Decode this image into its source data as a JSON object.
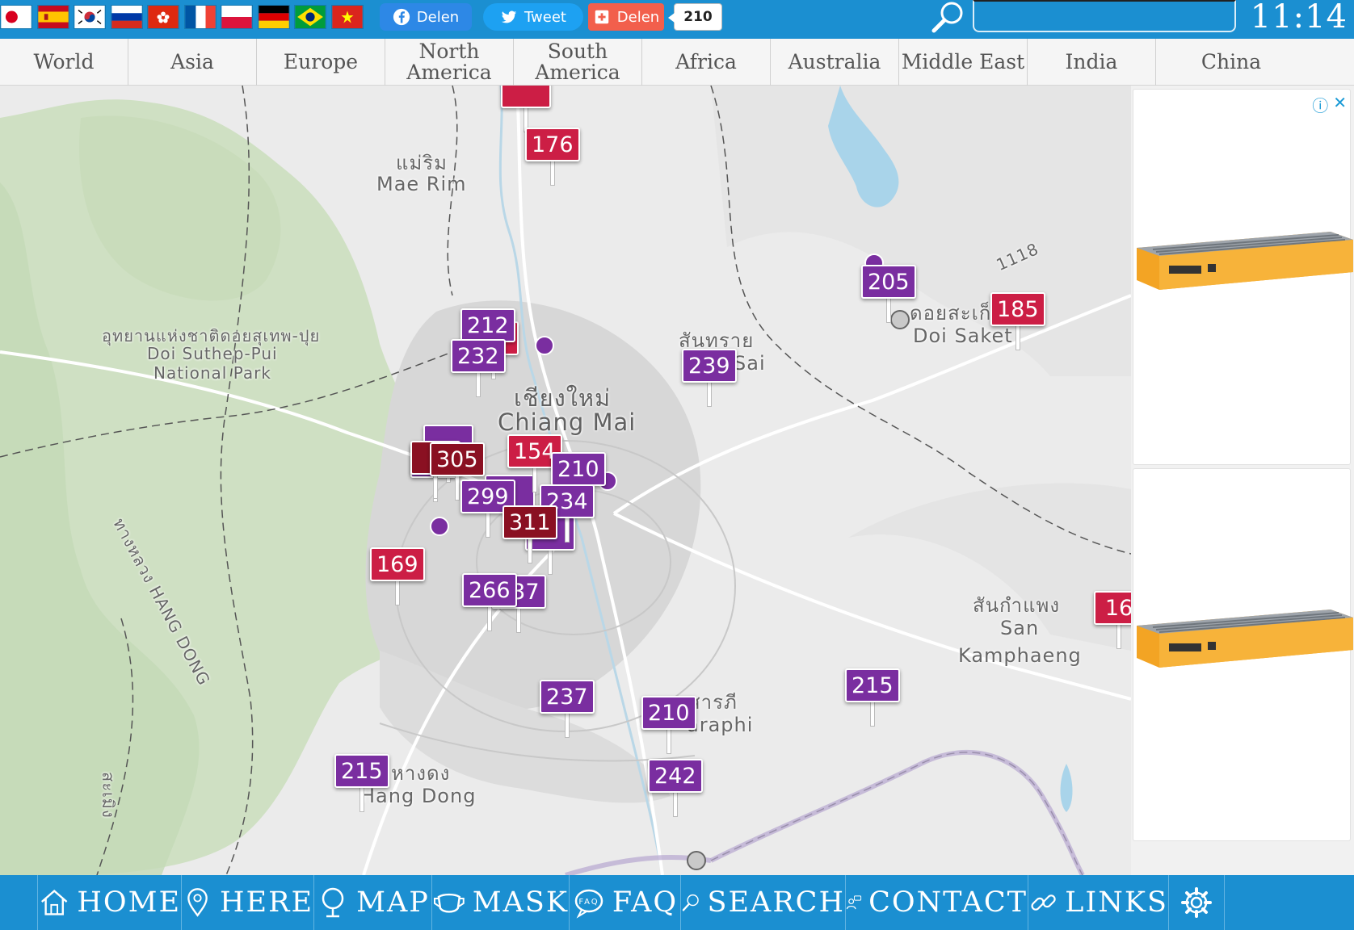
{
  "flags": [
    {
      "name": "japan-flag"
    },
    {
      "name": "spain-flag"
    },
    {
      "name": "korea-flag"
    },
    {
      "name": "russia-flag"
    },
    {
      "name": "hong-kong-flag"
    },
    {
      "name": "france-flag"
    },
    {
      "name": "poland-flag"
    },
    {
      "name": "germany-flag"
    },
    {
      "name": "brazil-flag"
    },
    {
      "name": "vietnam-flag"
    }
  ],
  "share": {
    "facebook_label": "Delen",
    "tweet_label": "Tweet",
    "add_label": "Delen",
    "count": "210"
  },
  "search": {
    "value": "",
    "placeholder": ""
  },
  "clock": "11:14",
  "tabs": [
    {
      "label": "World"
    },
    {
      "label": "Asia"
    },
    {
      "label": "Europe"
    },
    {
      "label": "North America"
    },
    {
      "label": "South America"
    },
    {
      "label": "Africa"
    },
    {
      "label": "Australia"
    },
    {
      "label": "Middle East"
    },
    {
      "label": "India"
    },
    {
      "label": "China"
    }
  ],
  "map": {
    "places": [
      {
        "text": "แม่ริม"
      },
      {
        "text": "Mae Rim"
      },
      {
        "text": "อุทยานแห่งชาติดอยสุเทพ-ปุย"
      },
      {
        "text": "Doi Suthep-Pui"
      },
      {
        "text": "National Park"
      },
      {
        "text": "เชียงใหม่"
      },
      {
        "text": "Chiang Mai"
      },
      {
        "text": "สันทราย"
      },
      {
        "text": "Sai"
      },
      {
        "text": "ดอยสะเก็ด"
      },
      {
        "text": "Doi Saket"
      },
      {
        "text": "สันกำแพง"
      },
      {
        "text": "San"
      },
      {
        "text": "Kamphaeng"
      },
      {
        "text": "หางดง"
      },
      {
        "text": "Hang Dong"
      },
      {
        "text": "สารภี"
      },
      {
        "text": "araphi"
      },
      {
        "text": "ทางหลวง HANG DONG"
      },
      {
        "text": "สะเมิง"
      },
      {
        "text": "1118"
      }
    ],
    "stations": [
      {
        "aqi": "176",
        "level": "unhealthy"
      },
      {
        "aqi": "212",
        "level": "very-unhealthy"
      },
      {
        "aqi": "232",
        "level": "very-unhealthy"
      },
      {
        "aqi": "239",
        "level": "very-unhealthy"
      },
      {
        "aqi": "205",
        "level": "very-unhealthy"
      },
      {
        "aqi": "185",
        "level": "unhealthy"
      },
      {
        "aqi": "154",
        "level": "unhealthy"
      },
      {
        "aqi": "305",
        "level": "hazardous"
      },
      {
        "aqi": "210",
        "level": "very-unhealthy"
      },
      {
        "aqi": "299",
        "level": "very-unhealthy"
      },
      {
        "aqi": "234",
        "level": "very-unhealthy"
      },
      {
        "aqi": "311",
        "level": "hazardous"
      },
      {
        "aqi": "169",
        "level": "unhealthy"
      },
      {
        "aqi": "266",
        "level": "very-unhealthy"
      },
      {
        "aqi": "237",
        "level": "very-unhealthy"
      },
      {
        "aqi": "237",
        "level": "very-unhealthy"
      },
      {
        "aqi": "210",
        "level": "very-unhealthy"
      },
      {
        "aqi": "215",
        "level": "very-unhealthy"
      },
      {
        "aqi": "242",
        "level": "very-unhealthy"
      },
      {
        "aqi": "215",
        "level": "very-unhealthy"
      },
      {
        "aqi": "16",
        "level": "unhealthy"
      }
    ]
  },
  "ad": {
    "info_icon": "info-icon",
    "close_icon": "close-icon"
  },
  "nav": [
    {
      "label": "HOME",
      "icon": "home-icon"
    },
    {
      "label": "HERE",
      "icon": "location-pin-icon"
    },
    {
      "label": "MAP",
      "icon": "map-pin-icon"
    },
    {
      "label": "MASK",
      "icon": "mask-icon"
    },
    {
      "label": "FAQ",
      "icon": "faq-icon"
    },
    {
      "label": "SEARCH",
      "icon": "search-icon"
    },
    {
      "label": "CONTACT",
      "icon": "contact-icon"
    },
    {
      "label": "LINKS",
      "icon": "link-icon"
    },
    {
      "label": "",
      "icon": "settings-gear-icon"
    }
  ],
  "colors": {
    "brand_blue": "#1b8fd1",
    "aqi_unhealthy": "#cc1e45",
    "aqi_very_unhealthy": "#7a2ea0",
    "aqi_hazardous": "#8a1022"
  }
}
